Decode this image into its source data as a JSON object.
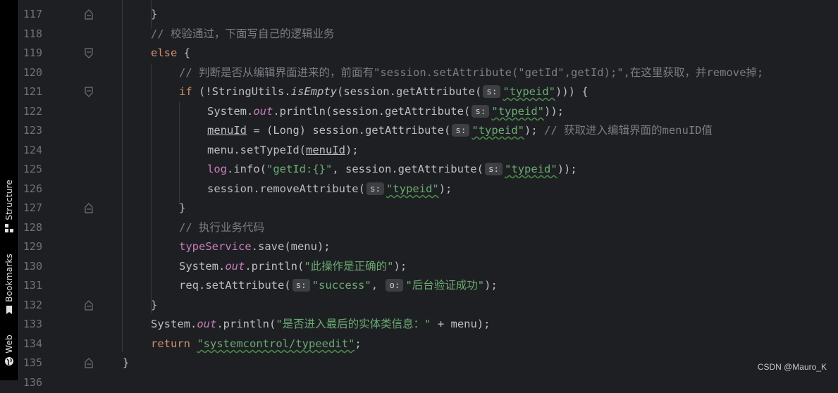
{
  "sidebar": {
    "tools": [
      {
        "label": "Structure",
        "icon": "structure-icon"
      },
      {
        "label": "Bookmarks",
        "icon": "bookmark-icon"
      },
      {
        "label": "Web",
        "icon": "globe-icon"
      }
    ]
  },
  "editor": {
    "line_numbers": [
      "117",
      "118",
      "119",
      "120",
      "121",
      "122",
      "123",
      "124",
      "125",
      "126",
      "127",
      "128",
      "129",
      "130",
      "131",
      "132",
      "133",
      "134",
      "135",
      "136"
    ],
    "lines": {
      "l117": {
        "brace": "}"
      },
      "l118": {
        "comment": "// 校验通过，下面写自己的逻辑业务"
      },
      "l119": {
        "kw": "else",
        "rest": " {"
      },
      "l120": {
        "comment": "// 判断是否从编辑界面进来的，前面有\"session.setAttribute(\"getId\",getId);\",在这里获取，并remove掉;"
      },
      "l121": {
        "kw": "if",
        "t1": " (!StringUtils.",
        "method": "isEmpty",
        "t2": "(session.getAttribute(",
        "hint": "s:",
        "str": "\"typeid\"",
        "t3": "))) {"
      },
      "l122": {
        "t1": "System.",
        "field": "out",
        "t2": ".println(session.getAttribute(",
        "hint": "s:",
        "str": "\"typeid\"",
        "t3": "));"
      },
      "l123": {
        "var": "menuId",
        "t1": " = (Long) session.getAttribute(",
        "hint": "s:",
        "str": "\"typeid\"",
        "t2": "); ",
        "comment": "// 获取进入编辑界面的menuID值"
      },
      "l124": {
        "t1": "menu.setTypeId(",
        "var": "menuId",
        "t2": ");"
      },
      "l125": {
        "field": "log",
        "t1": ".info(",
        "str1": "\"getId:{}\"",
        "t2": ", session.getAttribute(",
        "hint": "s:",
        "str2": "\"typeid\"",
        "t3": "));"
      },
      "l126": {
        "t1": "session.removeAttribute(",
        "hint": "s:",
        "str": "\"typeid\"",
        "t2": ");"
      },
      "l127": {
        "brace": "}"
      },
      "l128": {
        "comment": "// 执行业务代码"
      },
      "l129": {
        "field": "typeService",
        "t1": ".save(menu);"
      },
      "l130": {
        "t1": "System.",
        "field": "out",
        "t2": ".println(",
        "str": "\"此操作是正确的\"",
        "t3": ");"
      },
      "l131": {
        "t1": "req.setAttribute(",
        "hint1": "s:",
        "str1": "\"success\"",
        "t2": ", ",
        "hint2": "o:",
        "str2": "\"后台验证成功\"",
        "t3": ");"
      },
      "l132": {
        "brace": "}"
      },
      "l133": {
        "t1": "System.",
        "field": "out",
        "t2": ".println(",
        "str": "\"是否进入最后的实体类信息：\"",
        "t3": " + menu);"
      },
      "l134": {
        "kw": "return",
        "str": "\"systemcontrol/typeedit\"",
        "t1": ";"
      },
      "l135": {
        "brace": "}"
      }
    }
  },
  "watermark": "CSDN @Mauro_K",
  "colors": {
    "background": "#1e1f22",
    "keyword": "#cf8e6d",
    "string": "#6aab73",
    "comment": "#7a7e85",
    "field": "#c77dbb",
    "text": "#bcbec4",
    "line_number": "#6f737a"
  }
}
